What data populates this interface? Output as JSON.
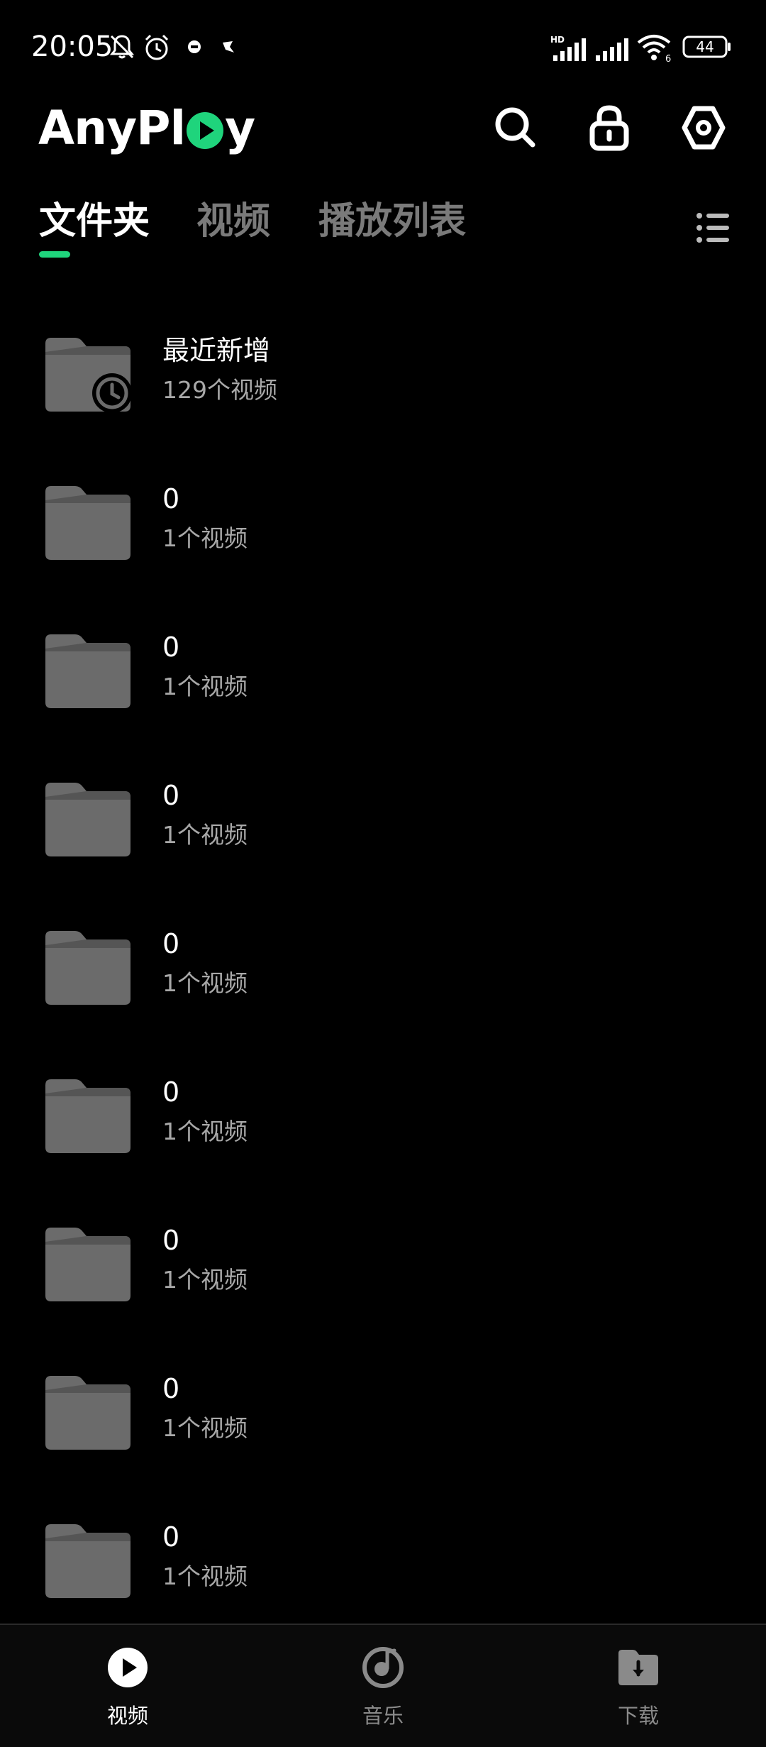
{
  "status_bar": {
    "time": "20:05",
    "battery": "44",
    "hd_label": "HD",
    "wifi_label": "6"
  },
  "header": {
    "logo_part1": "AnyPl",
    "logo_part2": "y",
    "search_icon": "search-icon",
    "lock_icon": "lock-icon",
    "settings_icon": "hexagon-settings-icon"
  },
  "tabs": [
    {
      "label": "文件夹",
      "active": true
    },
    {
      "label": "视频",
      "active": false
    },
    {
      "label": "播放列表",
      "active": false
    }
  ],
  "colors": {
    "accent": "#1fd47c",
    "background": "#000000",
    "folder": "#6b6b6b"
  },
  "folders": [
    {
      "name": "最近新增",
      "count": "129个视频",
      "icon": "recent-folder-icon"
    },
    {
      "name": "0",
      "count": "1个视频",
      "icon": "folder-icon"
    },
    {
      "name": "0",
      "count": "1个视频",
      "icon": "folder-icon"
    },
    {
      "name": "0",
      "count": "1个视频",
      "icon": "folder-icon"
    },
    {
      "name": "0",
      "count": "1个视频",
      "icon": "folder-icon"
    },
    {
      "name": "0",
      "count": "1个视频",
      "icon": "folder-icon"
    },
    {
      "name": "0",
      "count": "1个视频",
      "icon": "folder-icon"
    },
    {
      "name": "0",
      "count": "1个视频",
      "icon": "folder-icon"
    },
    {
      "name": "0",
      "count": "1个视频",
      "icon": "folder-icon"
    }
  ],
  "bottom_nav": [
    {
      "label": "视频",
      "icon": "play-circle-icon",
      "active": true
    },
    {
      "label": "音乐",
      "icon": "music-disc-icon",
      "active": false
    },
    {
      "label": "下载",
      "icon": "download-folder-icon",
      "active": false
    }
  ]
}
